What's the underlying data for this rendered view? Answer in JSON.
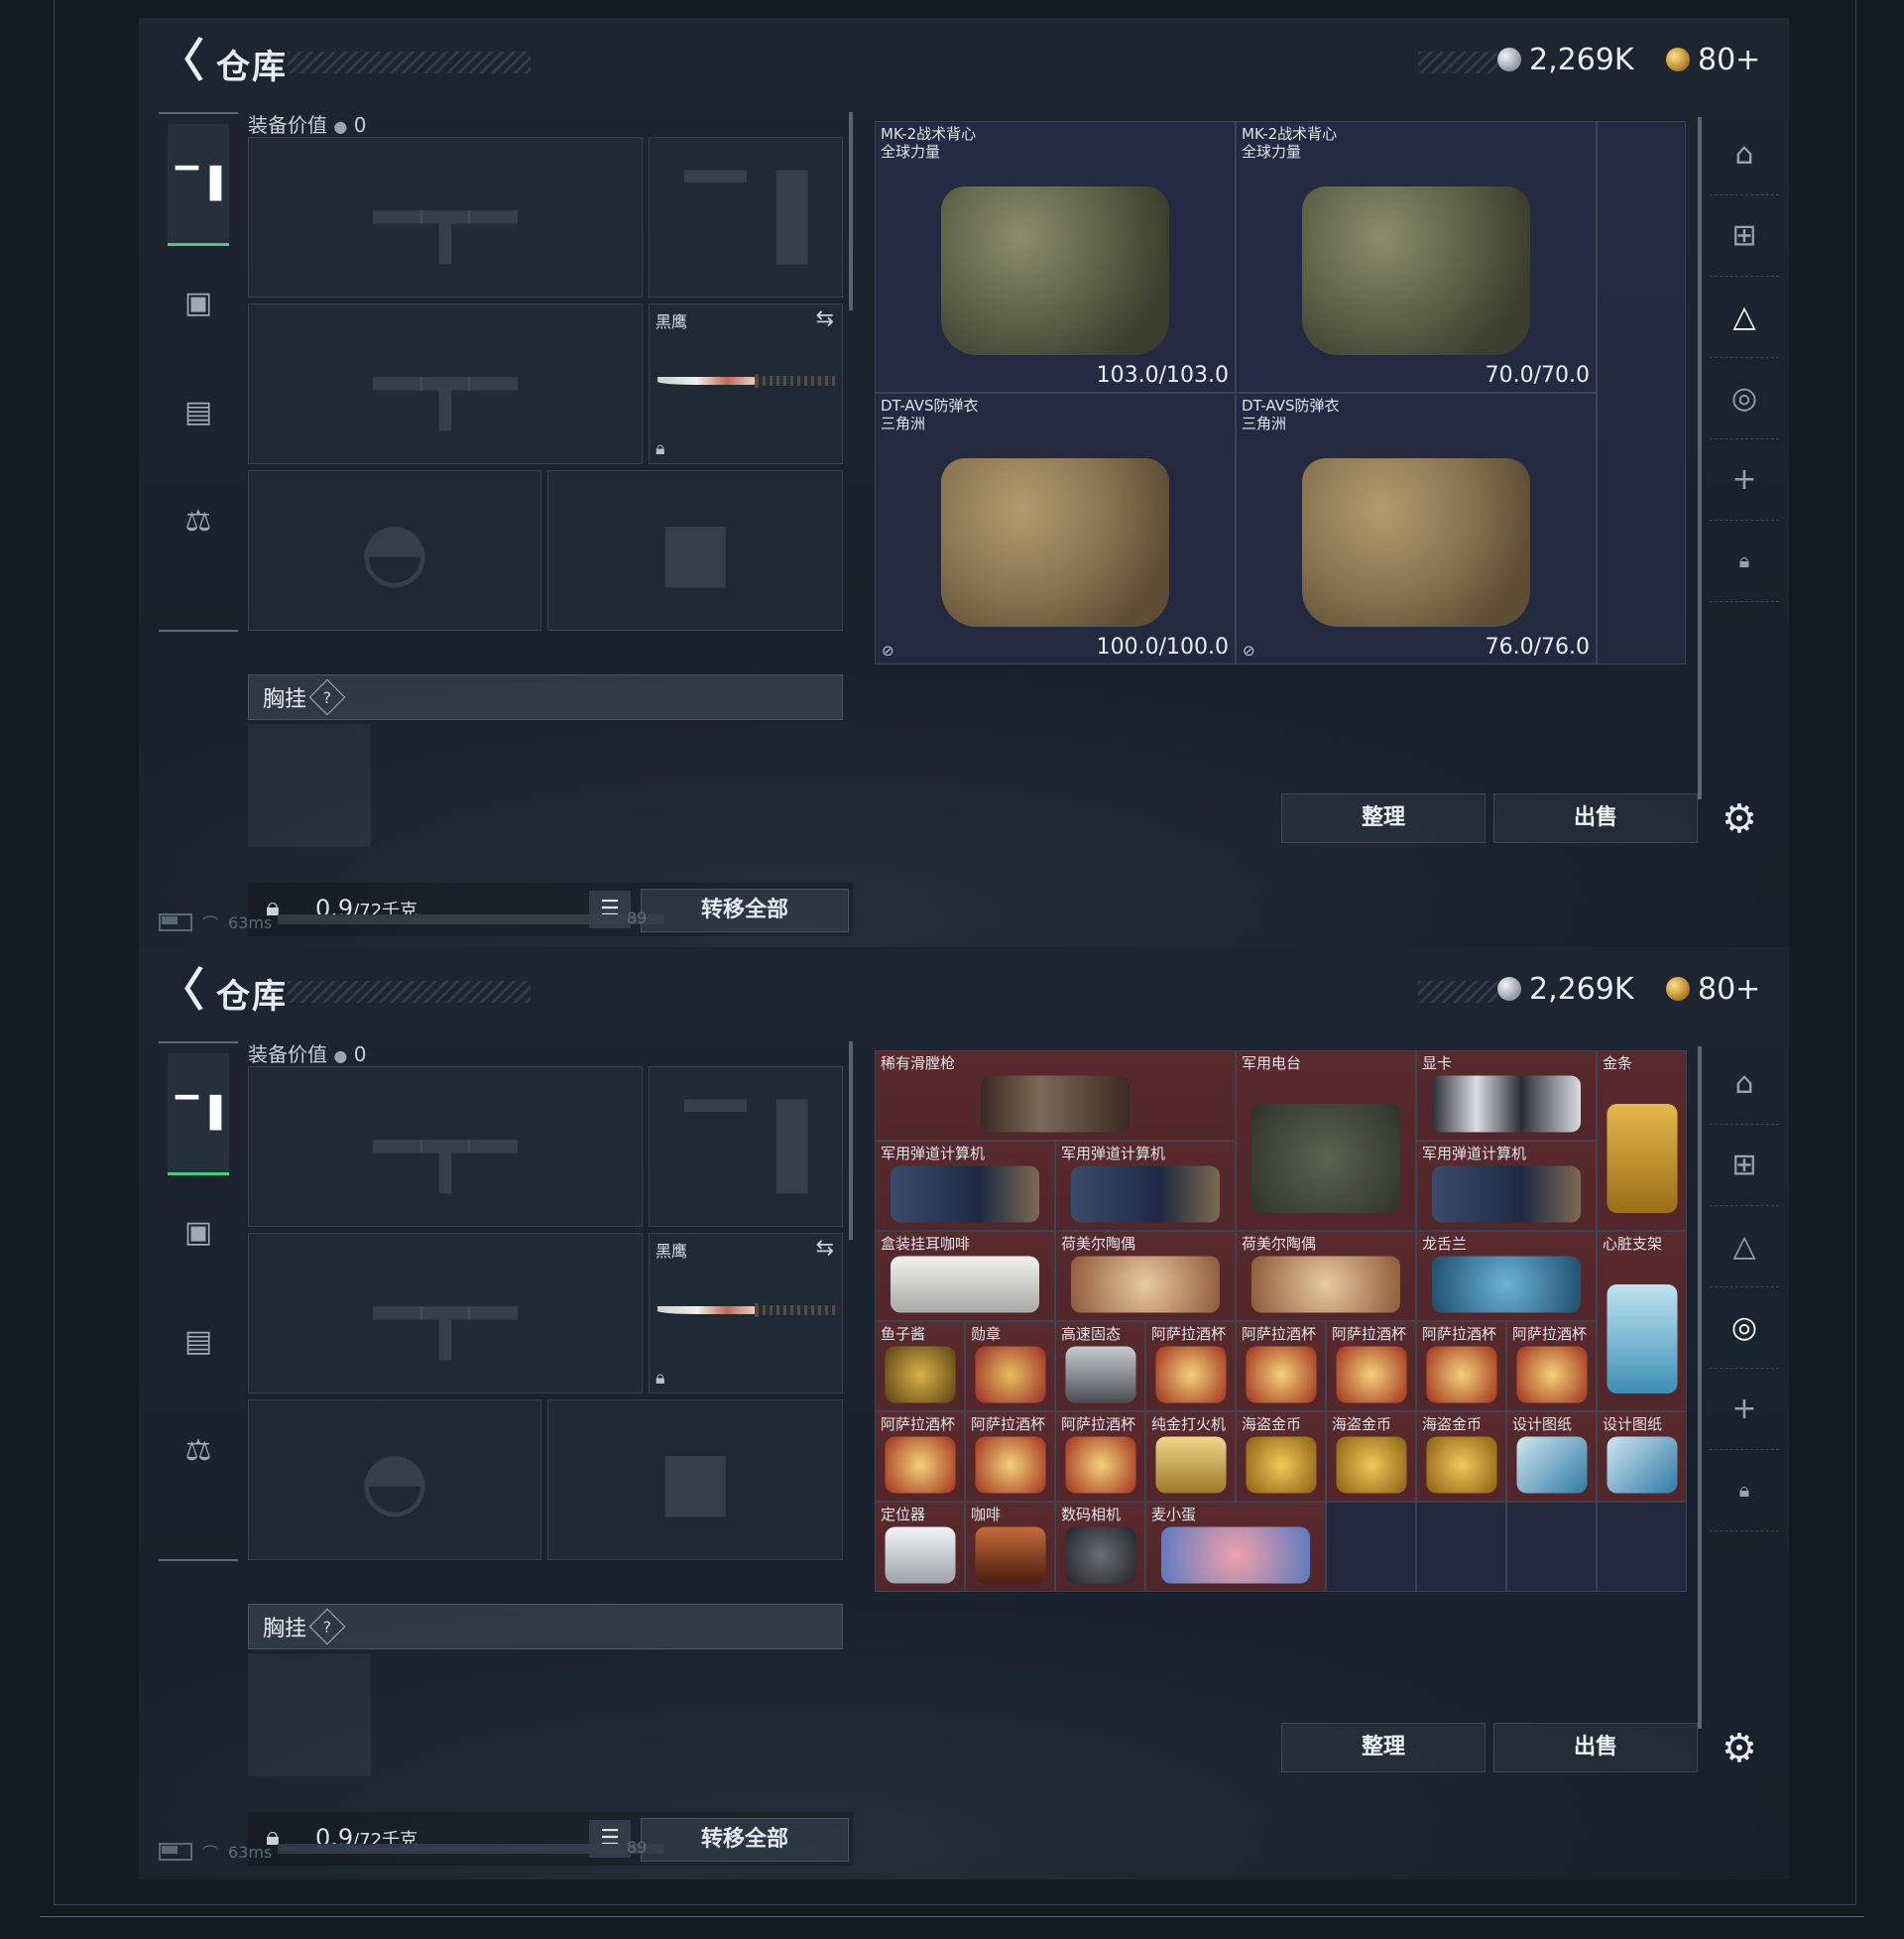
{
  "header": {
    "title": "仓库",
    "currency_silver": "2,269K",
    "currency_gold": "80+"
  },
  "equipment": {
    "value_label": "装备价值",
    "value": "0",
    "knife_name": "黑鹰",
    "chest_label": "胸挂",
    "chest_help": "?",
    "weight": "0.9",
    "weight_cap": "/72千克",
    "transfer_all": "转移全部"
  },
  "actions": {
    "sort": "整理",
    "sell": "出售"
  },
  "status": {
    "ping": "63ms",
    "num": "89"
  },
  "stash_top": [
    {
      "name": "MK-2战术背心",
      "sub": "全球力量",
      "durability": "103.0/103.0",
      "type": "mk"
    },
    {
      "name": "MK-2战术背心",
      "sub": "全球力量",
      "durability": "70.0/70.0",
      "type": "mk"
    },
    {
      "name": "DT-AVS防弹衣",
      "sub": "三角洲",
      "durability": "100.0/100.0",
      "type": "dt"
    },
    {
      "name": "DT-AVS防弹衣",
      "sub": "三角洲",
      "durability": "76.0/76.0",
      "type": "dt"
    }
  ],
  "stash_bottom": [
    {
      "name": "稀有滑膛枪"
    },
    {
      "name": "军用电台"
    },
    {
      "name": "显卡"
    },
    {
      "name": "金条"
    },
    {
      "name": "军用弹道计算机"
    },
    {
      "name": "军用弹道计算机"
    },
    {
      "name": "军用弹道计算机"
    },
    {
      "name": "盒装挂耳咖啡"
    },
    {
      "name": "荷美尔陶偶"
    },
    {
      "name": "荷美尔陶偶"
    },
    {
      "name": "龙舌兰"
    },
    {
      "name": "心脏支架"
    },
    {
      "name": "鱼子酱"
    },
    {
      "name": "勋章"
    },
    {
      "name": "高速固态"
    },
    {
      "name": "阿萨拉酒杯"
    },
    {
      "name": "阿萨拉酒杯"
    },
    {
      "name": "阿萨拉酒杯"
    },
    {
      "name": "阿萨拉酒杯"
    },
    {
      "name": "阿萨拉酒杯"
    },
    {
      "name": "阿萨拉酒杯"
    },
    {
      "name": "阿萨拉酒杯"
    },
    {
      "name": "阿萨拉酒杯"
    },
    {
      "name": "纯金打火机"
    },
    {
      "name": "海盗金币"
    },
    {
      "name": "海盗金币"
    },
    {
      "name": "海盗金币"
    },
    {
      "name": "设计图纸"
    },
    {
      "name": "设计图纸"
    },
    {
      "name": "定位器"
    },
    {
      "name": "咖啡"
    },
    {
      "name": "数码相机"
    },
    {
      "name": "麦小蛋"
    }
  ],
  "icons": {
    "side_tabs": [
      "pistol-icon",
      "backpack-icon",
      "chest-rig-icon",
      "medkit-icon"
    ],
    "right_tabs": [
      "stash-home-icon",
      "stash-page-2-icon",
      "stash-page-3-icon",
      "stash-page-4-icon",
      "add-page-icon",
      "lock-icon"
    ]
  },
  "colors": {
    "accent_green": "#3fd07a",
    "loot_background": "#5c2a2e"
  }
}
